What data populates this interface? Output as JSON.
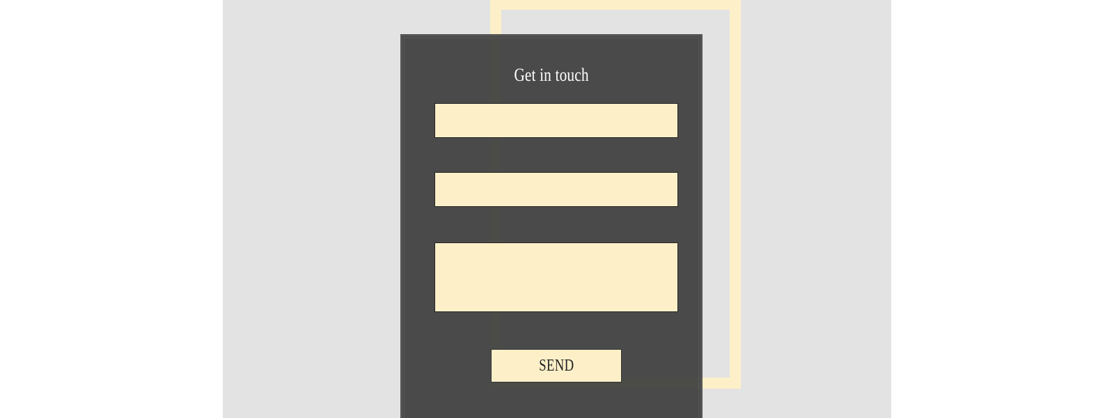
{
  "contact_form": {
    "title": "Get in touch",
    "name_field": {
      "value": "",
      "placeholder": ""
    },
    "email_field": {
      "value": "",
      "placeholder": ""
    },
    "message_field": {
      "value": "",
      "placeholder": ""
    },
    "send_label": "SEND"
  },
  "colors": {
    "page_background": "#ffffff",
    "stage_background": "#e3e3e3",
    "card_background": "#474747",
    "field_background": "#fdf0c8",
    "accent_frame": "#fdf0c8",
    "title_text": "#ffffff"
  }
}
